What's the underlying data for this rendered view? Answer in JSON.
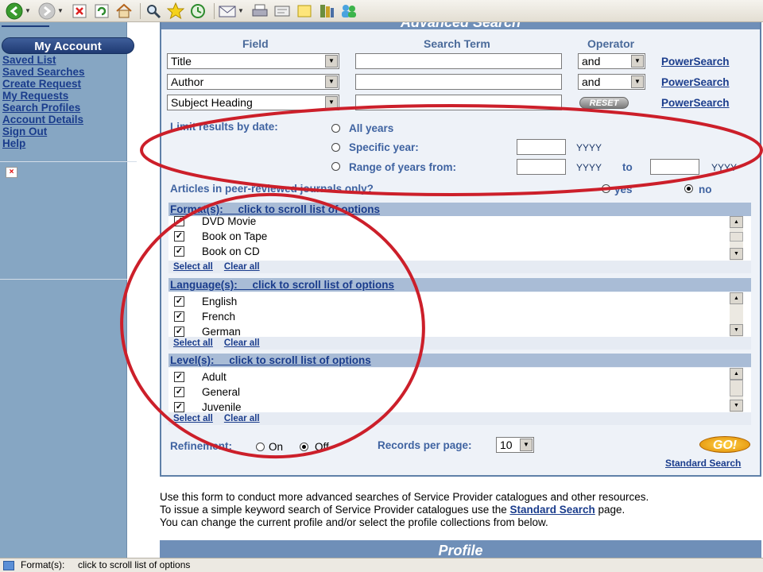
{
  "toolbar": {
    "buttons": [
      "back-icon",
      "forward-icon",
      "stop-icon",
      "refresh-icon",
      "home-icon",
      "search-icon",
      "favorites-icon",
      "history-icon",
      "mail-icon",
      "print-icon",
      "edit-icon",
      "discuss-icon",
      "research-icon",
      "messenger-icon"
    ]
  },
  "sidebar": {
    "header": "My Account",
    "links": [
      "Saved List",
      "Saved Searches",
      "Create Request",
      "My Requests",
      "Search Profiles",
      "Account Details",
      "Sign Out",
      "Help"
    ]
  },
  "panel": {
    "title": "Advanced Search",
    "headers": {
      "field": "Field",
      "term": "Search Term",
      "operator": "Operator"
    },
    "rows": [
      {
        "field": "Title",
        "operator": "and",
        "link": "PowerSearch"
      },
      {
        "field": "Author",
        "operator": "and",
        "link": "PowerSearch"
      },
      {
        "field": "Subject Heading",
        "operator": "",
        "link": "PowerSearch"
      }
    ],
    "reset_label": "RESET",
    "limit_label": "Limit results by date:",
    "date_options": {
      "all": "All years",
      "specific": "Specific year:",
      "range": "Range of years from:",
      "to": "to",
      "yyyy": "YYYY"
    },
    "peer_label": "Articles in peer-reviewed journals only?",
    "peer_yes": "yes",
    "peer_no": "no",
    "formats": {
      "header": "Format(s):     click to scroll list of options",
      "items": [
        "DVD Movie",
        "Book on Tape",
        "Book on CD"
      ]
    },
    "languages": {
      "header": "Language(s):     click to scroll list of options",
      "items": [
        "English",
        "French",
        "German"
      ]
    },
    "levels": {
      "header": "Level(s):     click to scroll list of options",
      "items": [
        "Adult",
        "General",
        "Juvenile"
      ]
    },
    "select_all": "Select all",
    "clear_all": "Clear all",
    "refinement_label": "Refinement:",
    "refine_on": "On",
    "refine_off": "Off",
    "records_label": "Records per page:",
    "records_value": "10",
    "go_label": "GO!",
    "standard_link": "Standard Search"
  },
  "info": {
    "line1": "Use this form to conduct more advanced searches of Service Provider catalogues and other resources.",
    "line2_pre": "To issue a simple keyword search of Service Provider catalogues use the ",
    "line2_link": "Standard Search",
    "line2_post": " page.",
    "line3": "You can change the current profile and/or select the profile collections from below."
  },
  "profile_title": "Profile",
  "status_text": "Format(s):     click to scroll list of options",
  "colors": {
    "annotation": "#cc1f2a",
    "sidebar": "#86a6c3",
    "panel_bg": "#eef2f8",
    "link": "#1a3c8c"
  }
}
